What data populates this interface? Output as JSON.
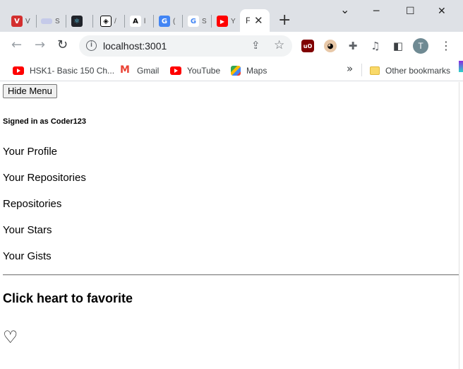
{
  "browser": {
    "tabs": [
      {
        "icon": "vivaldi-tab-icon",
        "stub": "V",
        "color": "#d32f2f",
        "glyph": "V"
      },
      {
        "icon": "doc-tab-icon",
        "stub": "S",
        "color": "#c5cae9",
        "glyph": ""
      },
      {
        "icon": "react-tab-icon",
        "stub": "",
        "color": "#20232a",
        "glyph": "⚛"
      },
      {
        "icon": "codepen-tab-icon",
        "stub": "/",
        "color": "#ffffff",
        "glyph": "◈"
      },
      {
        "icon": "translate-tab-icon",
        "stub": "l",
        "color": "#ffffff",
        "glyph": "A"
      },
      {
        "icon": "google-translate-tab-icon",
        "stub": "(",
        "color": "#4285f4",
        "glyph": "G"
      },
      {
        "icon": "google-tab-icon",
        "stub": "S",
        "color": "#ffffff",
        "glyph": "G"
      },
      {
        "icon": "youtube-tab-icon",
        "stub": "Y",
        "color": "#ff0000",
        "glyph": "▶"
      }
    ],
    "active_tab": {
      "stub": "F",
      "close": "✕"
    },
    "new_tab": "+",
    "window_controls": {
      "minimize": "─",
      "maximize": "☐",
      "close": "✕",
      "dropdown": "⌄"
    },
    "nav": {
      "back": "←",
      "forward": "→",
      "reload": "↻"
    },
    "address": {
      "url": "localhost:3001",
      "info": "i"
    },
    "profile_initial": "T",
    "bookmarks": [
      {
        "label": "HSK1- Basic 150 Ch..."
      },
      {
        "label": "Gmail"
      },
      {
        "label": "YouTube"
      },
      {
        "label": "Maps"
      }
    ],
    "more_bookmarks": "»",
    "other_bookmarks": "Other bookmarks"
  },
  "app": {
    "hide_menu_label": "Hide Menu",
    "signed_in_text": "Signed in as Coder123",
    "menu_items": [
      {
        "label": "Your Profile"
      },
      {
        "label": "Your Repositories"
      },
      {
        "label": "Repositories"
      },
      {
        "label": "Your Stars"
      },
      {
        "label": "Your Gists"
      }
    ],
    "favorite_heading": "Click heart to favorite",
    "heart_glyph": "♡"
  }
}
